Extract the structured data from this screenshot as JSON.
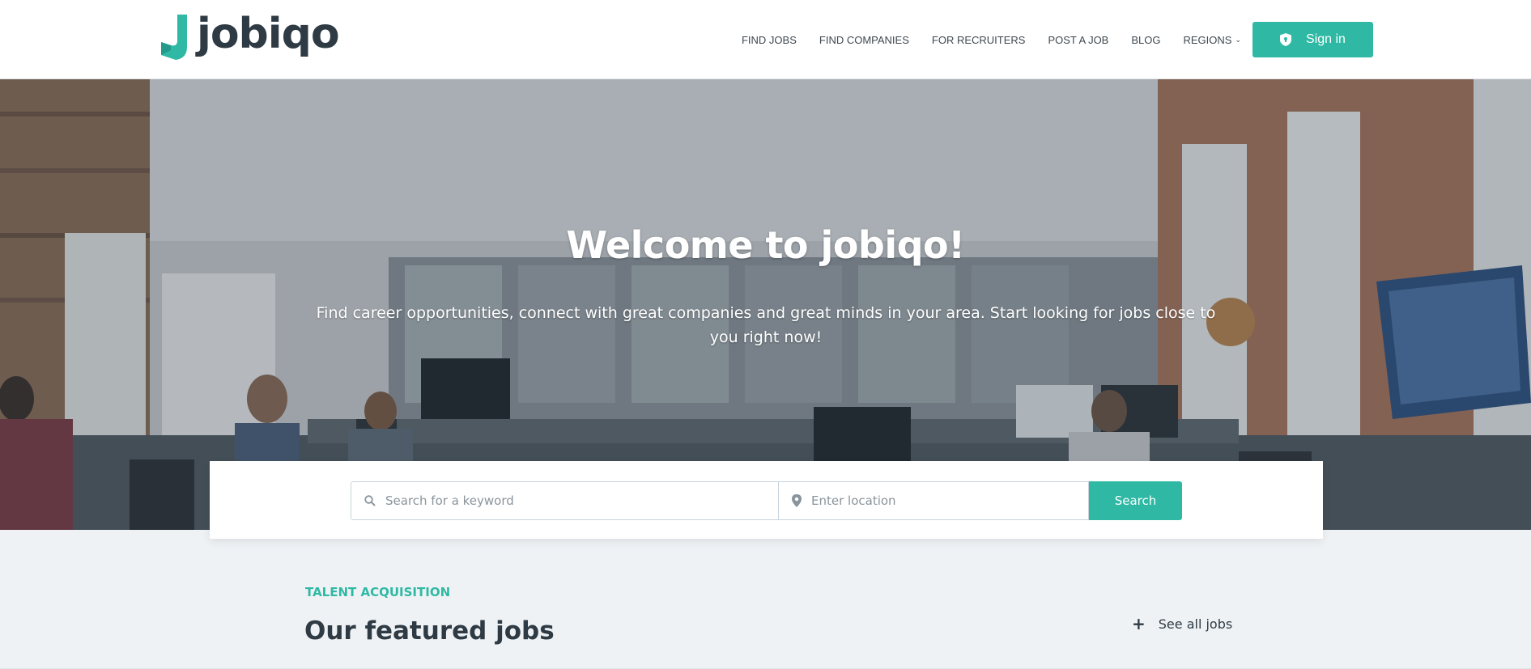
{
  "brand": {
    "logo_text": "jobiqo",
    "accent_color": "#2fb9a4",
    "logo_mark_icon": "jobiqo-j-mark-icon"
  },
  "nav": {
    "items": [
      {
        "label": "FIND JOBS"
      },
      {
        "label": "FIND COMPANIES"
      },
      {
        "label": "FOR RECRUITERS"
      },
      {
        "label": "POST A JOB"
      },
      {
        "label": "BLOG"
      },
      {
        "label": "REGIONS",
        "icon": "chevron-down-icon"
      }
    ],
    "signin_label": "Sign in",
    "signin_icon": "shield-icon"
  },
  "hero": {
    "title": "Welcome to jobiqo!",
    "subtitle": "Find career opportunities, connect with great companies and great minds in your area. Start looking for jobs close to you right now!",
    "background": "office-photo"
  },
  "search": {
    "keyword_placeholder": "Search for a keyword",
    "keyword_icon": "search-icon",
    "location_placeholder": "Enter location",
    "location_icon": "map-pin-icon",
    "button_label": "Search"
  },
  "featured": {
    "kicker": "TALENT ACQUISITION",
    "title": "Our featured jobs",
    "see_all_label": "See all jobs",
    "see_all_icon": "plus-icon"
  }
}
